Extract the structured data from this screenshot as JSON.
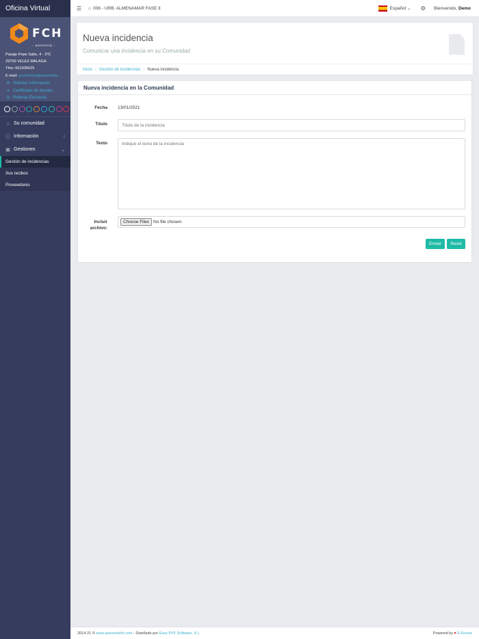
{
  "sidebar": {
    "app_title": "Oficina Virtual",
    "logo_text": "FCH",
    "logo_sub": "- asesoria -",
    "address_line1": "Pasaje Pepe Salto, 4 - 2ºC",
    "address_line2": "29700 VELEZ MALAGA",
    "phone": "Tfno: 661935625",
    "email_label": "E-mail:",
    "email": "acontreras@asesoriafc...",
    "links": [
      {
        "label": "Solicitar Información",
        "icon": "envelope-icon"
      },
      {
        "label": "Certificado de deudas",
        "icon": "trophy-icon"
      },
      {
        "label": "Rellenar Encuesta",
        "icon": "clock-icon"
      }
    ],
    "circle_colors": [
      "#ffffff",
      "#8fa3a8",
      "#b14fb1",
      "#2fb1b0",
      "#d88a30",
      "#2fa9e0",
      "#2fb7b1",
      "#c63a8b",
      "#d8384a"
    ],
    "menu": [
      {
        "label": "Su comunidad",
        "icon": "home-icon"
      },
      {
        "label": "Información",
        "icon": "info-icon"
      },
      {
        "label": "Gestiones",
        "icon": "briefcase-icon"
      }
    ],
    "submenu": [
      {
        "label": "Gestión de incidencias",
        "active": true
      },
      {
        "label": "Sus recibos"
      },
      {
        "label": "Proveedores"
      }
    ]
  },
  "topbar": {
    "community": "006 - URB. ALMENAMAR FASE II",
    "language": "Español",
    "welcome_prefix": "Bienvenido,",
    "user": "Demo"
  },
  "page_header": {
    "title": "Nueva incidencia",
    "subtitle": "Comunicar una incidencia en su Comunidad",
    "breadcrumbs": [
      "Inicio",
      "Gestión de incidencias",
      "Nueva incidencia"
    ]
  },
  "form": {
    "panel_title": "Nueva incidencia en la Comunidad",
    "fecha_label": "Fecha",
    "fecha_value": "13/01/2021",
    "titulo_label": "Título",
    "titulo_placeholder": "Título de la incidencia",
    "texto_label": "Texto",
    "texto_placeholder": "Indique el texto de la incidencia",
    "archivo_label_1": "Incluir",
    "archivo_label_2": "archivo:",
    "file_button": "Choose Files",
    "file_status": "No file chosen",
    "submit_label": "Enviar",
    "reset_label": "Reset"
  },
  "footer": {
    "copyright": "2014-21 ©",
    "site_link": "www.asesoriafch.com",
    "designed_by": "- Diseñado por",
    "designer_link": "Easy PVF Software, S.L.",
    "powered_by": "Powered by",
    "powered_link": "E-Fincas"
  }
}
